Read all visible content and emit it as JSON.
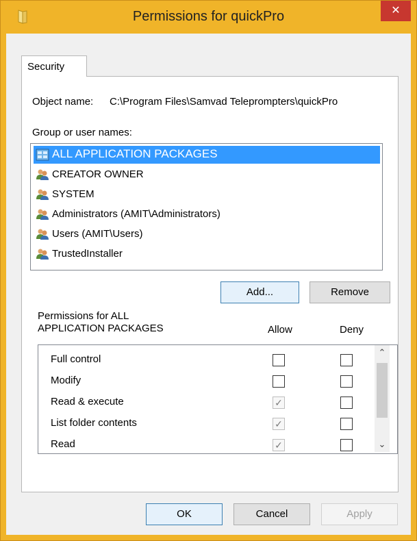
{
  "window": {
    "title": "Permissions for quickPro",
    "close_glyph": "✕"
  },
  "tabs": [
    {
      "label": "Security"
    }
  ],
  "object": {
    "label": "Object name:",
    "value": "C:\\Program Files\\Samvad Teleprompters\\quickPro"
  },
  "groups": {
    "label": "Group or user names:",
    "items": [
      {
        "name": "ALL APPLICATION PACKAGES",
        "icon": "app-packages-icon",
        "selected": true
      },
      {
        "name": "CREATOR OWNER",
        "icon": "users-icon",
        "selected": false
      },
      {
        "name": "SYSTEM",
        "icon": "users-icon",
        "selected": false
      },
      {
        "name": "Administrators (AMIT\\Administrators)",
        "icon": "users-icon",
        "selected": false
      },
      {
        "name": "Users (AMIT\\Users)",
        "icon": "users-icon",
        "selected": false
      },
      {
        "name": "TrustedInstaller",
        "icon": "users-icon",
        "selected": false
      }
    ]
  },
  "buttons": {
    "add": "Add...",
    "remove": "Remove",
    "ok": "OK",
    "cancel": "Cancel",
    "apply": "Apply"
  },
  "permissions": {
    "header_line1": "Permissions for ALL",
    "header_line2": "APPLICATION PACKAGES",
    "allow_label": "Allow",
    "deny_label": "Deny",
    "check_glyph": "✓",
    "rows": [
      {
        "name": "Full control",
        "allow": false,
        "allow_disabled": false,
        "deny": false
      },
      {
        "name": "Modify",
        "allow": false,
        "allow_disabled": false,
        "deny": false
      },
      {
        "name": "Read & execute",
        "allow": true,
        "allow_disabled": true,
        "deny": false
      },
      {
        "name": "List folder contents",
        "allow": true,
        "allow_disabled": true,
        "deny": false
      },
      {
        "name": "Read",
        "allow": true,
        "allow_disabled": true,
        "deny": false
      }
    ]
  },
  "colors": {
    "title_bar": "#f0b429",
    "close_button": "#c7372f",
    "selection": "#3399ff"
  }
}
